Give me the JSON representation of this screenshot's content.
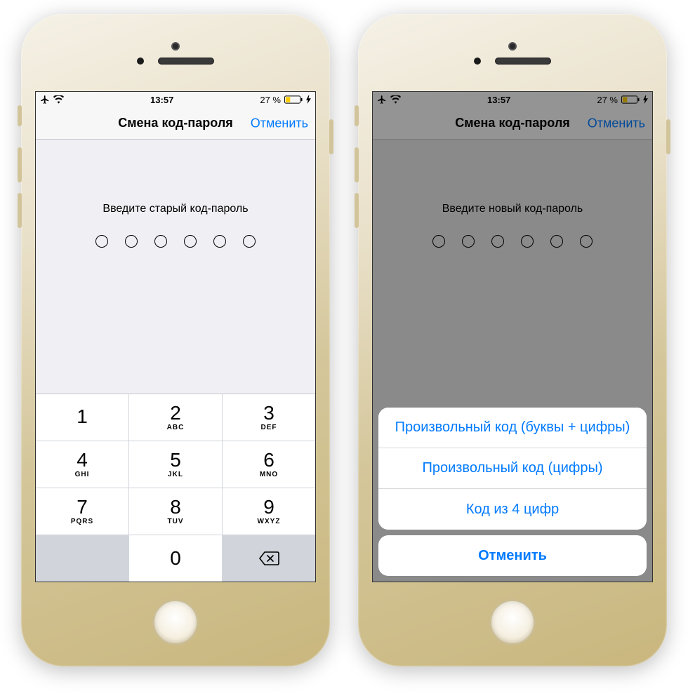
{
  "status": {
    "time": "13:57",
    "battery_text": "27 %"
  },
  "nav": {
    "title": "Смена код-пароля",
    "cancel": "Отменить"
  },
  "left": {
    "prompt": "Введите старый код-пароль",
    "keys": [
      {
        "digit": "1",
        "letters": ""
      },
      {
        "digit": "2",
        "letters": "ABC"
      },
      {
        "digit": "3",
        "letters": "DEF"
      },
      {
        "digit": "4",
        "letters": "GHI"
      },
      {
        "digit": "5",
        "letters": "JKL"
      },
      {
        "digit": "6",
        "letters": "MNO"
      },
      {
        "digit": "7",
        "letters": "PQRS"
      },
      {
        "digit": "8",
        "letters": "TUV"
      },
      {
        "digit": "9",
        "letters": "WXYZ"
      },
      {
        "digit": "0",
        "letters": ""
      }
    ]
  },
  "right": {
    "prompt": "Введите новый код-пароль",
    "options": [
      "Произвольный код (буквы + цифры)",
      "Произвольный код (цифры)",
      "Код из 4 цифр"
    ],
    "cancel": "Отменить"
  }
}
